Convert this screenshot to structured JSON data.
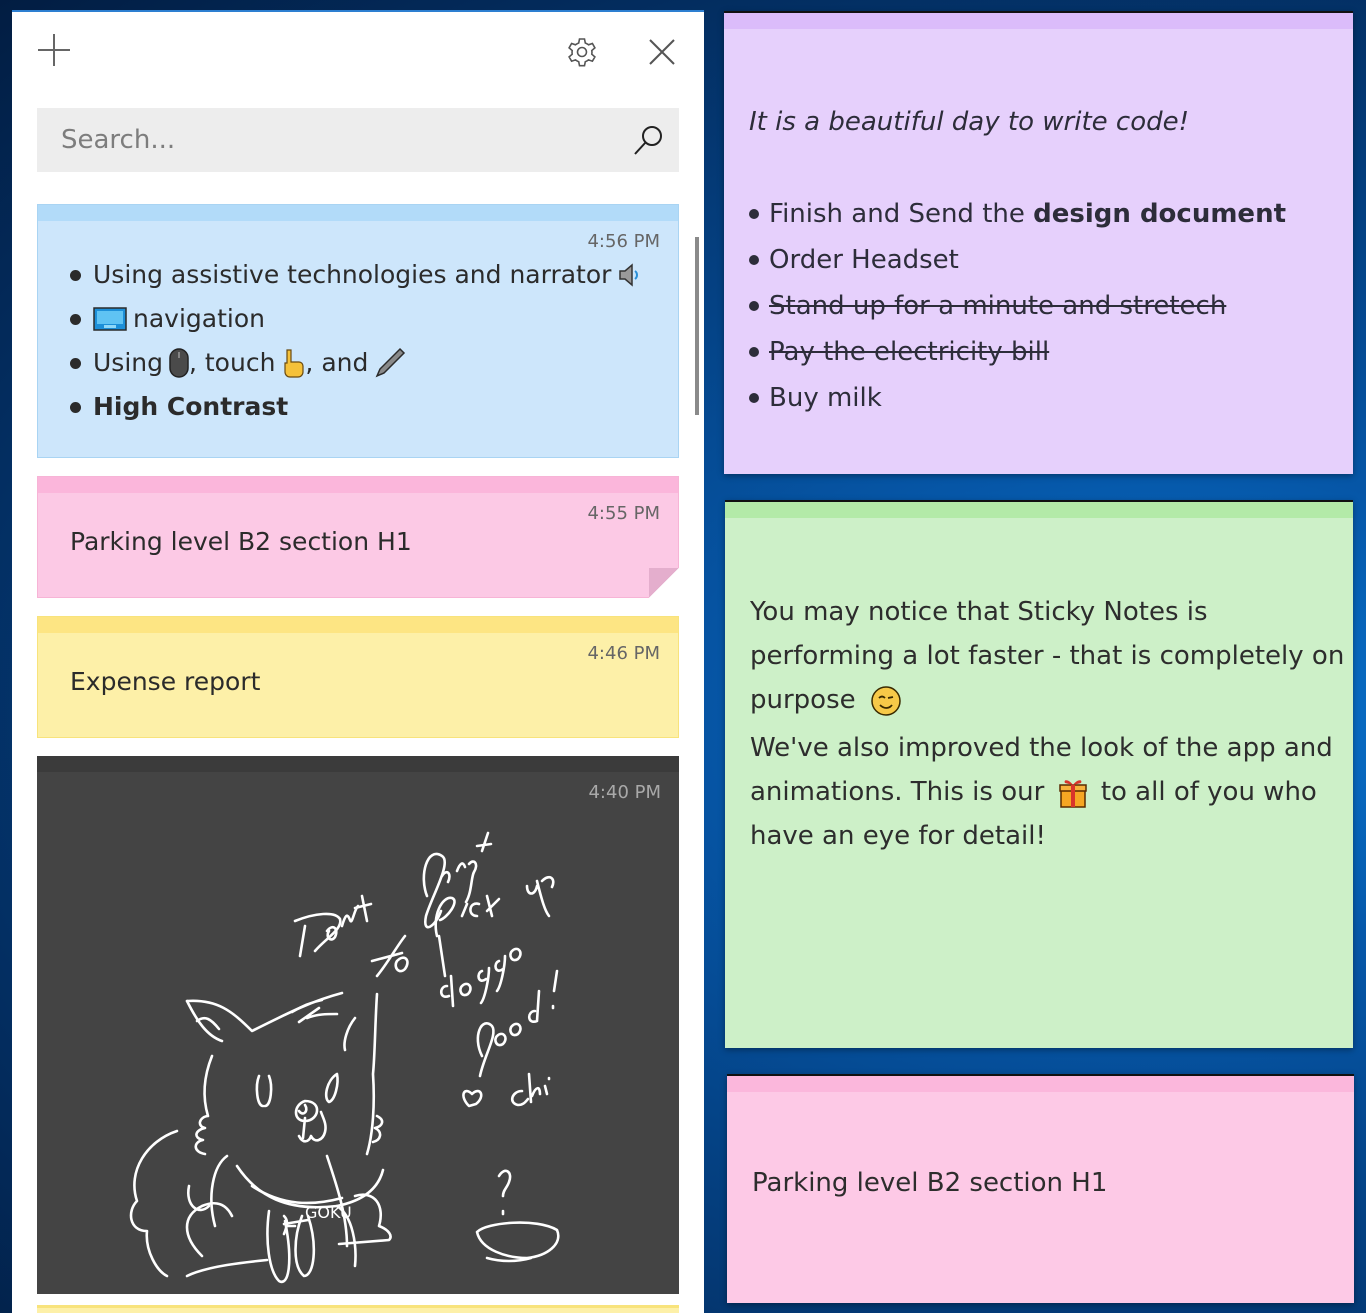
{
  "app": {
    "add_label": "New note",
    "settings_label": "Settings",
    "close_label": "Close"
  },
  "search": {
    "placeholder": "Search...",
    "value": ""
  },
  "notes_list": [
    {
      "color": "blue",
      "time": "4:56 PM",
      "items": [
        {
          "text": "Using assistive technologies and narrator",
          "emoji_after": "speaker-icon"
        },
        {
          "emoji_before": "keyboard-icon",
          "text": "navigation"
        },
        {
          "text_a": "Using",
          "emoji_a": "mouse-icon",
          "text_b": ", touch",
          "emoji_b": "pointing-hand-icon",
          "text_c": ", and",
          "emoji_c": "pen-icon"
        },
        {
          "text": "High Contrast",
          "bold": true
        }
      ]
    },
    {
      "color": "pink",
      "time": "4:55 PM",
      "text": "Parking level B2 section H1"
    },
    {
      "color": "yellow",
      "time": "4:46 PM",
      "text": "Expense report"
    },
    {
      "color": "charcoal",
      "time": "4:40 PM",
      "ink_text": "Don't forget to pick up doggo food! ♡ chi",
      "ink_label": "GOKU"
    }
  ],
  "floating_notes": {
    "purple": {
      "intro": "It is a beautiful day to write code!",
      "items": [
        {
          "text_plain": "Finish and Send the ",
          "text_bold": "design document",
          "done": false
        },
        {
          "text": "Order Headset",
          "done": false
        },
        {
          "text": "Stand up for a minute and stretech",
          "done": true
        },
        {
          "text": "Pay the electricity bill",
          "done": true
        },
        {
          "text": "Buy milk",
          "done": false
        }
      ]
    },
    "green": {
      "para1_a": "You may notice that Sticky Notes is performing a lot faster - that is completely on purpose",
      "para1_emoji": "winking-face-icon",
      "para2_a": "We've also improved the look of the app and animations. This is our",
      "para2_emoji": "gift-icon",
      "para2_b": "to all of you who have an eye for detail!"
    },
    "pink": {
      "text": "Parking level B2 section H1"
    }
  },
  "colors": {
    "blue_note": "#cde6fb",
    "pink_note": "#fcc9e5",
    "yellow_note": "#fdf0a8",
    "charcoal_note": "#444444",
    "purple_note": "#e6d0fc",
    "green_note": "#cdf0c8"
  }
}
